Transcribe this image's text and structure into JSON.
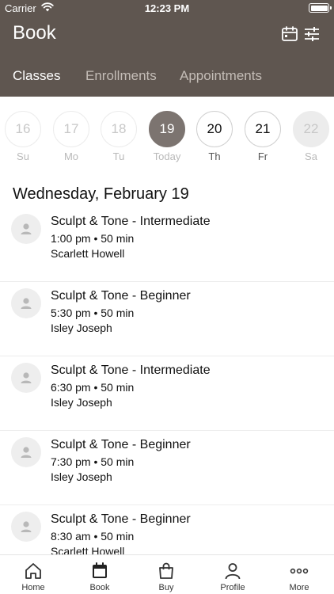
{
  "status_bar": {
    "carrier": "Carrier",
    "time": "12:23 PM"
  },
  "header": {
    "title": "Book",
    "tabs": [
      {
        "label": "Classes",
        "active": true
      },
      {
        "label": "Enrollments",
        "active": false
      },
      {
        "label": "Appointments",
        "active": false
      }
    ]
  },
  "date_strip": {
    "days": [
      {
        "date": "16",
        "weekday": "Su",
        "state": "past"
      },
      {
        "date": "17",
        "weekday": "Mo",
        "state": "past"
      },
      {
        "date": "18",
        "weekday": "Tu",
        "state": "past"
      },
      {
        "date": "19",
        "weekday": "Today",
        "state": "selected"
      },
      {
        "date": "20",
        "weekday": "Th",
        "state": "active"
      },
      {
        "date": "21",
        "weekday": "Fr",
        "state": "active"
      },
      {
        "date": "22",
        "weekday": "Sa",
        "state": "disabled"
      }
    ]
  },
  "schedule": {
    "date_heading": "Wednesday, February 19",
    "classes": [
      {
        "name": "Sculpt & Tone - Intermediate",
        "time": "1:00 pm • 50 min",
        "instructor": "Scarlett Howell"
      },
      {
        "name": "Sculpt & Tone - Beginner",
        "time": "5:30 pm • 50 min",
        "instructor": "Isley Joseph"
      },
      {
        "name": "Sculpt & Tone - Intermediate",
        "time": "6:30 pm • 50 min",
        "instructor": "Isley Joseph"
      },
      {
        "name": "Sculpt & Tone - Beginner",
        "time": "7:30 pm • 50 min",
        "instructor": "Isley Joseph"
      },
      {
        "name": "Sculpt & Tone - Beginner",
        "time": "8:30 am • 50 min",
        "instructor": "Scarlett Howell"
      }
    ]
  },
  "tab_bar": {
    "items": [
      {
        "label": "Home",
        "icon": "home-icon"
      },
      {
        "label": "Book",
        "icon": "calendar-icon",
        "active": true
      },
      {
        "label": "Buy",
        "icon": "shopping-bag-icon"
      },
      {
        "label": "Profile",
        "icon": "person-icon"
      },
      {
        "label": "More",
        "icon": "more-dots-icon"
      }
    ]
  },
  "colors": {
    "header_bg": "#5f5650",
    "selected_day": "#7c7470",
    "inactive_tab": "#c4bdb7"
  }
}
